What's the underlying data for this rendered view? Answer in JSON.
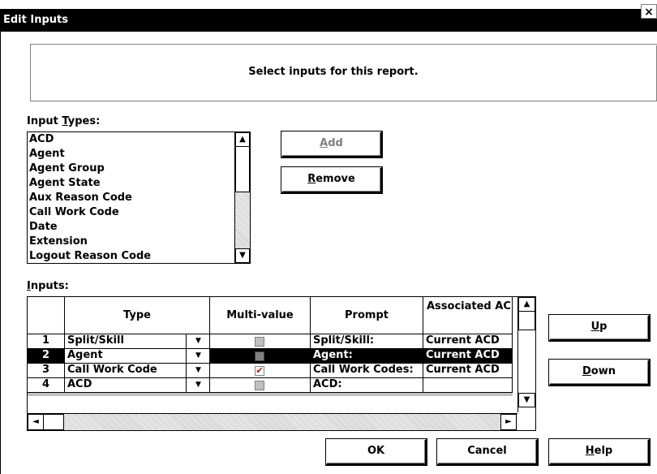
{
  "dialog": {
    "title": "Edit Inputs",
    "close_glyph": "×"
  },
  "message": "Select inputs for this report.",
  "input_types": {
    "label_pre": "Input ",
    "label_accel": "T",
    "label_post": "ypes:",
    "items": [
      "ACD",
      "Agent",
      "Agent Group",
      "Agent State",
      "Aux Reason Code",
      "Call Work Code",
      "Date",
      "Extension",
      "Logout Reason Code"
    ]
  },
  "buttons": {
    "add": {
      "accel": "A",
      "rest": "dd"
    },
    "remove": {
      "accel": "R",
      "rest": "emove"
    },
    "up": {
      "accel": "U",
      "rest": "p"
    },
    "down": {
      "accel": "D",
      "rest": "own"
    },
    "ok": "OK",
    "cancel": "Cancel",
    "help": {
      "accel": "H",
      "rest": "elp"
    }
  },
  "inputs": {
    "label_accel": "I",
    "label_rest": "nputs:",
    "columns": [
      "Type",
      "Multi-value",
      "Prompt",
      "Associated AC"
    ],
    "rows": [
      {
        "num": "1",
        "type": "Split/Skill",
        "multi_value": false,
        "prompt": "Split/Skill:",
        "associated": "Current ACD",
        "selected": false
      },
      {
        "num": "2",
        "type": "Agent",
        "multi_value": false,
        "prompt": "Agent:",
        "associated": "Current ACD",
        "selected": true
      },
      {
        "num": "3",
        "type": "Call Work Code",
        "multi_value": true,
        "prompt": "Call Work Codes:",
        "associated": "Current ACD",
        "selected": false
      },
      {
        "num": "4",
        "type": "ACD",
        "multi_value": false,
        "prompt": "ACD:",
        "associated": "",
        "selected": false
      }
    ]
  },
  "icons": {
    "scroll_up": "▲",
    "scroll_down": "▼",
    "scroll_left": "◄",
    "scroll_right": "►",
    "dropdown": "▼",
    "check": "✔"
  },
  "colors": {
    "titlebar": "#000000",
    "selection": "#000000",
    "check": "#e00000"
  }
}
